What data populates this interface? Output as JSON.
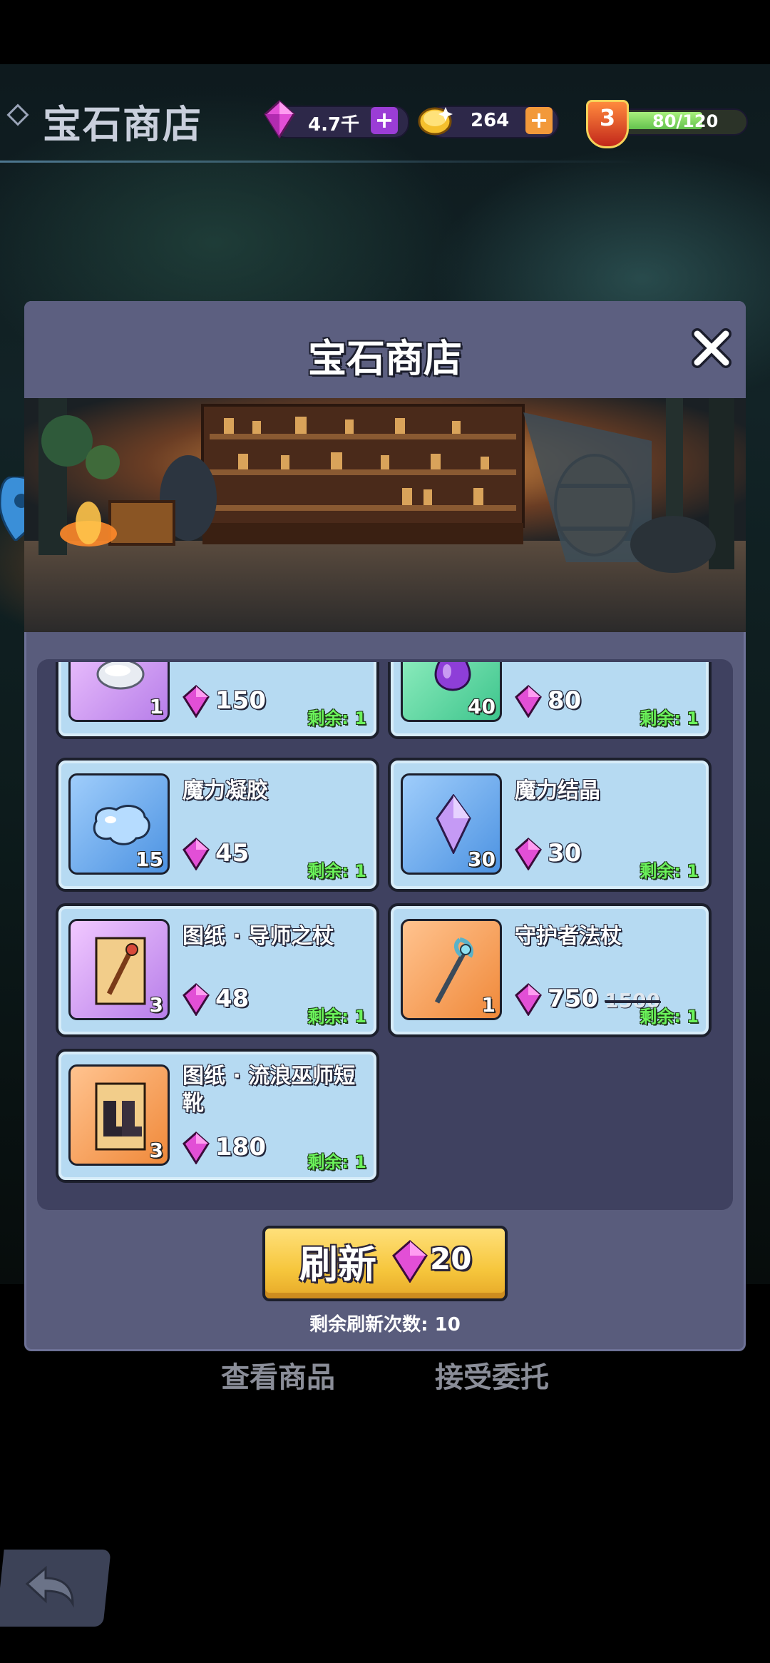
{
  "top_bar": {
    "title": "宝石商店",
    "gems": "4.7千",
    "gold": "264",
    "level": "3",
    "xp": "80/120",
    "xp_fraction": 0.667
  },
  "modal": {
    "title": "宝石商店"
  },
  "items": [
    {
      "name": "",
      "qty": "1",
      "price": "150",
      "old_price": "",
      "remaining": "剩余: 1",
      "icon": "silver-coin-icon",
      "bg": "purple"
    },
    {
      "name": "",
      "qty": "40",
      "price": "80",
      "old_price": "",
      "remaining": "剩余: 1",
      "icon": "purple-drop-icon",
      "bg": "green"
    },
    {
      "name": "魔力凝胶",
      "qty": "15",
      "price": "45",
      "old_price": "",
      "remaining": "剩余: 1",
      "icon": "blue-gel-icon",
      "bg": "blue"
    },
    {
      "name": "魔力结晶",
      "qty": "30",
      "price": "30",
      "old_price": "",
      "remaining": "剩余: 1",
      "icon": "purple-crystal-icon",
      "bg": "blue"
    },
    {
      "name": "图纸 · 导师之杖",
      "qty": "3",
      "price": "48",
      "old_price": "",
      "remaining": "剩余: 1",
      "icon": "staff-blueprint-icon",
      "bg": "purple"
    },
    {
      "name": "守护者法杖",
      "qty": "1",
      "price": "750",
      "old_price": "1500",
      "remaining": "剩余: 1",
      "icon": "guardian-staff-icon",
      "bg": "orange"
    },
    {
      "name": "图纸 · 流浪巫师短靴",
      "qty": "3",
      "price": "180",
      "old_price": "",
      "remaining": "剩余: 1",
      "icon": "boots-blueprint-icon",
      "bg": "orange"
    }
  ],
  "refresh": {
    "label": "刷新",
    "cost": "20",
    "remaining_text": "剩余刷新次数: 10"
  },
  "tabs": {
    "view": "查看商品",
    "accept": "接受委托"
  }
}
